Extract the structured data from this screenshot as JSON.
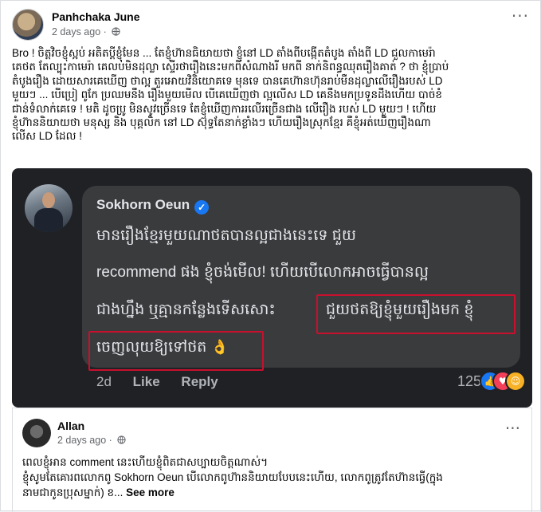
{
  "post": {
    "author": "Panhchaka June",
    "time": "2 days ago",
    "time_sep": "·",
    "more": "···",
    "body_lines": [
      "Bro ! ចិត្តវិចខ្ញុំស្អប់ អតិតប្ដីខ្ញុំមែន ... តែខ្ញុំហ៊ានធិយាយថា ខ្ញុំនៅ LD តាំងពីបង្កើតតំបូង តាំងពី LD ជួលកាមេរ៉ា",
      "គេថត តែល្បុះកាមេរ៉ា គេលប់មិនដុល្លា ស្ទើរថារឿងនេះមកពីសំណាងរី មកពី នាក់និពន្ធឈុតរឿងគាត់ ? ថា ខ្ញុំប្រាប់",
      "តំបូងរឿង ដោយសារគេឃើញ ថាល្អ តួរអោយវិនិយោគទេ មុនទេ បានគេហ៊ានហ៊ុនរាប់មឺនដុល្លាលើរឿងរបស់ LD",
      "មួយៗ ... បើប្រៀ ពូកែ ប្រឈមនឹង រឿងមួយមើល បើគេឃើញថា ល្អលើស LD គេនឹងមកប្រទូនដឹងហើយ បាច់ខំ",
      "ជាន់ទំលាក់គេទេ ! មតិ ដូចប្រូ មិនសូវច្រើនទេ តែខ្ញុំឃើញការរលើរច្រើនជាង លើរឿង របស់ LD មួយៗ ! ហើយ",
      "ខ្ញុំហ៊ាននិយាយថា មនុស្ស និង បុគ្គលិក នៅ LD ស៊ុទ្ធតែនាក់ខ្លាំងៗ ហើយរឿងស្រុកខ្មែរ គឺខ្ញុំអត់ឃើញរឿងណា",
      "លើស LD ដែល !"
    ]
  },
  "shared_comment": {
    "name": "Sokhorn Oeun",
    "verified_symbol": "✓",
    "lines": [
      "មានរឿងខ្មែរមួយណាថតបានល្អជាងនេះទេ ជួយ",
      "recommend ផង ខ្ញុំចង់មើល! ហើយបើលោកអាចធ្វើបានល្អ",
      "ជាងហ្នឹង ឬគ្មានកន្លែងទើសសោះ",
      "ជួយថតឱ្យខ្ញុំមួយរឿងមក ខ្ញុំ",
      "ចេញលុយឱ្យទៅថត",
      "👌"
    ],
    "time": "2d",
    "like_label": "Like",
    "reply_label": "Reply",
    "reaction_count": "125",
    "reaction_like_symbol": "👍",
    "reaction_love_symbol": "♥",
    "reaction_care_symbol": "☺",
    "highlight_color": "#c8102e"
  },
  "reply": {
    "author": "Allan",
    "time": "2 days ago",
    "time_sep": "·",
    "more": "···",
    "line1": "ពេលខ្ញុំអាន comment នេះហើយខ្ញុំពិតជាសប្បាយចិត្តណាស់។",
    "line2": "ខ្ញុំសូមតែគោរពលោកពូ Sokhorn Oeun បើលោកពូហ៊ាននិយាយបែបនេះហើយ, លោកពូត្រូវតែហ៊ានធ្វើ(ក្នុង",
    "line3": "នាមជាកូនប្រុសម្នាក់) ខ...",
    "see_more": "See more"
  }
}
